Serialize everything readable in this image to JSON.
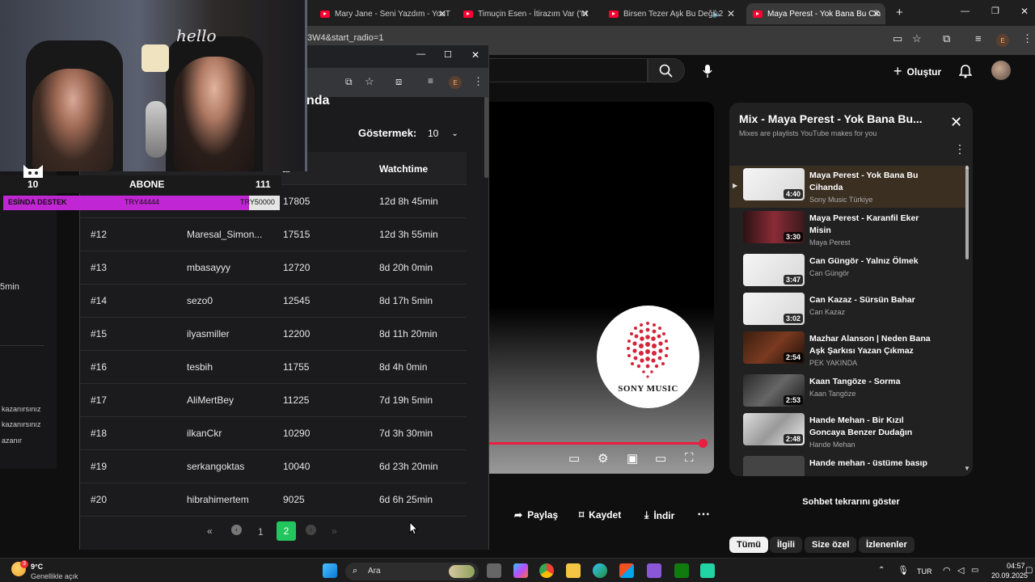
{
  "browser": {
    "tabs": [
      {
        "title": "Mary Jane - Seni Yazdım - YouT"
      },
      {
        "title": "Timuçin Esen - İtirazım Var ('M"
      },
      {
        "title": "Birsen Tezer Aşk Bu Değil 2"
      },
      {
        "title": "Maya Perest - Yok Bana Bu Cih"
      }
    ],
    "url_fragment": "3W4&start_radio=1",
    "profile_initial": "E"
  },
  "youtube": {
    "create_label": "Oluştur",
    "video": {
      "brand_text": "SONY MUSIC"
    },
    "actions": {
      "share": "Paylaş",
      "save": "Kaydet",
      "download": "İndir"
    },
    "playlist": {
      "title": "Mix - Maya Perest - Yok Bana Bu...",
      "subtitle": "Mixes are playlists YouTube makes for you",
      "items": [
        {
          "title": "Maya Perest - Yok Bana Bu Cihanda",
          "channel": "Sony Music Türkiye",
          "duration": "4:40",
          "playing": true
        },
        {
          "title": "Maya Perest - Karanfil Eker Misin",
          "channel": "Maya Perest",
          "duration": "3:30"
        },
        {
          "title": "Can Güngör - Yalnız Ölmek",
          "channel": "Can Güngör",
          "duration": "3:47"
        },
        {
          "title": "Can Kazaz - Sürsün Bahar",
          "channel": "Can Kazaz",
          "duration": "3:02"
        },
        {
          "title": "Mazhar Alanson | Neden Bana Aşk Şarkısı Yazan Çıkmaz",
          "channel": "PEK YAKINDA",
          "duration": "2:54"
        },
        {
          "title": "Kaan Tangöze - Sorma",
          "channel": "Kaan Tangöze",
          "duration": "2:53"
        },
        {
          "title": "Hande Mehan - Bir Kızıl Goncaya Benzer Dudağın",
          "channel": "Hande Mehan",
          "duration": "2:48"
        },
        {
          "title": "Hande mehan - üstüme basıp",
          "channel": "",
          "duration": ""
        }
      ]
    },
    "chat_replay": "Sohbet tekrarını göster",
    "chips": [
      "Tümü",
      "İlgili",
      "Size özel",
      "İzlenenler"
    ]
  },
  "popup": {
    "heading_fragment": "nda",
    "show_label": "Göstermek:",
    "show_value": "10",
    "columns": {
      "points_fragment": "ar",
      "watchtime": "Watchtime"
    },
    "rows": [
      {
        "rank": "",
        "user": "",
        "points": "17805",
        "watchtime": "12d 8h 45min"
      },
      {
        "rank": "#12",
        "user": "Maresal_Simon...",
        "points": "17515",
        "watchtime": "12d 3h 55min"
      },
      {
        "rank": "#13",
        "user": "mbasayyy",
        "points": "12720",
        "watchtime": "8d 20h 0min"
      },
      {
        "rank": "#14",
        "user": "sezo0",
        "points": "12545",
        "watchtime": "8d 17h 5min"
      },
      {
        "rank": "#15",
        "user": "ilyasmiller",
        "points": "12200",
        "watchtime": "8d 11h 20min"
      },
      {
        "rank": "#16",
        "user": "tesbih",
        "points": "11755",
        "watchtime": "8d 4h 0min"
      },
      {
        "rank": "#17",
        "user": "AliMertBey",
        "points": "11225",
        "watchtime": "7d 19h 5min"
      },
      {
        "rank": "#18",
        "user": "ilkanCkr",
        "points": "10290",
        "watchtime": "7d 3h 30min"
      },
      {
        "rank": "#19",
        "user": "serkangoktas",
        "points": "10040",
        "watchtime": "6d 23h 20min"
      },
      {
        "rank": "#20",
        "user": "hibrahimertem",
        "points": "9025",
        "watchtime": "6d 6h 25min"
      }
    ],
    "pages": [
      "1",
      "2"
    ],
    "current_page": "2"
  },
  "overlay": {
    "count_left": "10",
    "abone_label": "ABONE",
    "count_right": "111",
    "bar_left": "ESİNDA DESTEK",
    "bar_mid": "TRY44444",
    "bar_right": "TRY50000",
    "hello_text": "hello",
    "left_fragments": [
      "5min",
      "kazanırsınız",
      "kazanırsınız",
      "azanır"
    ]
  },
  "taskbar": {
    "weather_temp": "9°C",
    "weather_desc": "Genellikle açık",
    "weather_badge": "3",
    "search_placeholder": "Ara",
    "lang": "TUR",
    "time": "04:57",
    "date": "20.09.2025"
  },
  "colors": {
    "accent_red": "#ff0033",
    "progress_red": "#e91e40",
    "page_green": "#22c55e",
    "goal_purple": "#c026d3"
  }
}
